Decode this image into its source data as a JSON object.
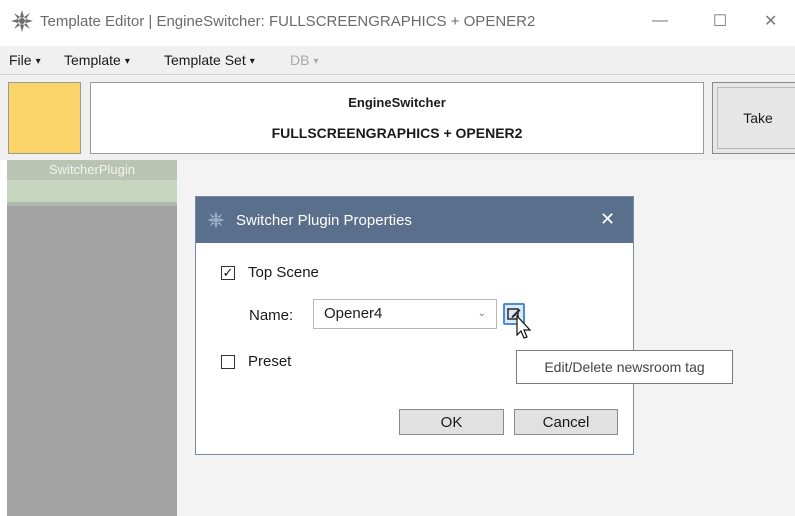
{
  "window": {
    "title": "Template Editor | EngineSwitcher: FULLSCREENGRAPHICS + OPENER2",
    "minimize_glyph": "—",
    "maximize_glyph": "☐",
    "close_glyph": "✕",
    "icon": "gear-flower-icon"
  },
  "menubar": {
    "items": [
      {
        "label": "File",
        "enabled": true
      },
      {
        "label": "Template",
        "enabled": true
      },
      {
        "label": "Template Set",
        "enabled": true
      },
      {
        "label": "DB",
        "enabled": false
      }
    ],
    "caret": "▾"
  },
  "header": {
    "swatch_color": "#fcd56a",
    "line1": "EngineSwitcher",
    "line2": "FULLSCREENGRAPHICS + OPENER2",
    "take_label": "Take"
  },
  "left_panel": {
    "plugin_label": "SwitcherPlugin"
  },
  "dialog": {
    "title": "Switcher Plugin Properties",
    "close_glyph": "✕",
    "top_scene": {
      "label": "Top Scene",
      "checked": true,
      "check_glyph": "✓"
    },
    "name_label": "Name:",
    "name_value": "Opener4",
    "dropdown_glyph": "⌄",
    "preset": {
      "label": "Preset",
      "checked": false
    },
    "ok_label": "OK",
    "cancel_label": "Cancel"
  },
  "tooltip": {
    "text": "Edit/Delete newsroom tag"
  },
  "colors": {
    "dialog_titlebar": "#5a6f8c",
    "left_panel": "#a3a3a3",
    "plugin_selected": "#c6d6bf"
  }
}
